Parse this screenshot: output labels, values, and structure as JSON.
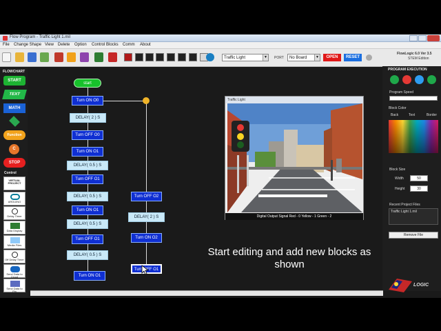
{
  "window": {
    "title": "Flow Program - Traffic Light 1.mil"
  },
  "menu": [
    "File",
    "Change Shape",
    "View",
    "Delete",
    "Option",
    "Control Blocks",
    "Comm",
    "About"
  ],
  "toolbar": {
    "project_select": "Traffic Light",
    "port_label": "PORT",
    "port_select": "No Board",
    "open_label": "OPEN",
    "reset_label": "RESET",
    "version_line1": "FlowLogic 6.0 Ver 3.5",
    "version_line2": "STEM Edition"
  },
  "palette": {
    "heading": "FLOWCHART",
    "start": "START",
    "text": "TEXT",
    "math": "MATH",
    "function": "Function",
    "c_letter": "C",
    "stop": "STOP",
    "control_heading": "Control",
    "virtual_project": "VIRTUAL PROJECT",
    "arduino": "ARDUINO",
    "delay_timer": "Delay Timer",
    "data_display": "Data Display",
    "media_files": "Media Files",
    "off_delay_timer": "Off Delay Timer",
    "send_data_to_cloud": "Send Data to Cloud",
    "send_data_to_pin": "Send Data to Pin"
  },
  "flowchart": {
    "start": "start",
    "main_column": [
      "Turn ON O0",
      "DELAY( 2 ) S",
      "Turn OFF O0",
      "Turn ON O1",
      "DELAY( 0.5 ) S",
      "Turn OFF O1",
      "DELAY( 0.5 ) S",
      "Turn ON O1",
      "DELAY( 0.5 ) S",
      "Turn OFF O1",
      "DELAY( 0.5 ) S",
      "Turn ON O1"
    ],
    "side_column": [
      "Turn OFF O2",
      "DELAY( 2 ) S",
      "Turn ON O2",
      "Turn OFF O1"
    ]
  },
  "traffic_window": {
    "title": "Traffic Light",
    "status": "Digital Output Signal    Red - 0   Yellow - 1   Green - 2"
  },
  "right_panel": {
    "program_execution": "PROGRAM EXECUTION",
    "program_speed": "Program Speed",
    "block_color": "Block Color",
    "color_options": [
      "Back",
      "Text",
      "Border"
    ],
    "block_size": "Block Size",
    "width_label": "Width",
    "width_value": "50",
    "height_label": "Height",
    "height_value": "30",
    "recent_files": "Recent Project Files",
    "recent_item": "Traffic Light 1.mil",
    "remove_file": "Remove File"
  },
  "caption": "Start editing and add new blocks as shown",
  "logo_text": "LOGIC",
  "colors": {
    "block_blue": "#0f2fd2",
    "delay_fill": "#c9e9f8",
    "start_green": "#17c12b",
    "open_red": "#e01818",
    "reset_blue": "#1b6fe0"
  }
}
